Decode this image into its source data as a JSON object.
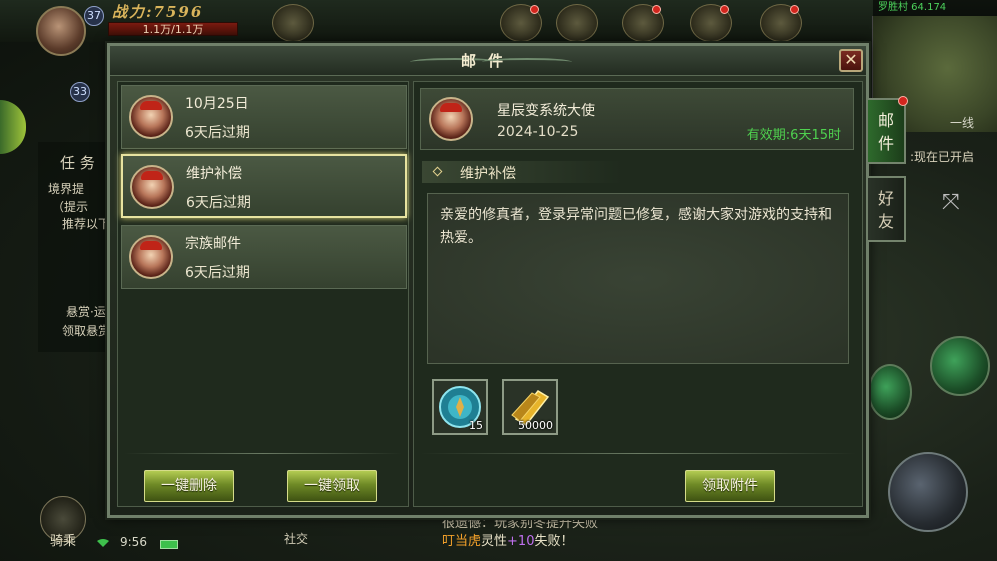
{
  "hud": {
    "power": "战力:7596",
    "hp": "1.1万/1.1万",
    "level_main": "37",
    "level_pet": "33",
    "map_coords": "罗胜村 64.174",
    "line": "一线",
    "quest_tab": "任 务",
    "quest_1": "境界提",
    "quest_1_hint": "（提示",
    "quest_1_sub": "推荐以下",
    "quest_2": "悬赏·运",
    "quest_2_sub": "领取悬赏",
    "time": "9:56",
    "ride": "骑乘",
    "social": "社交",
    "chat_line1": "很遗憾：玩家别冬提升失败",
    "chat_name": "叮当虎",
    "chat_pre": "灵性",
    "chat_plus": "+10",
    "chat_post": "失败！",
    "minimap_note": ":现在已开启"
  },
  "dialog": {
    "title": "邮件",
    "close_label": "✕"
  },
  "mail_list": [
    {
      "subject": "10月25日",
      "expiry": "6天后过期"
    },
    {
      "subject": "维护补偿",
      "expiry": "6天后过期"
    },
    {
      "subject": "宗族邮件",
      "expiry": "6天后过期"
    }
  ],
  "buttons": {
    "delete_all": "一键删除",
    "claim_all": "一键领取",
    "claim_attachment": "领取附件"
  },
  "detail": {
    "sender": "星辰变系统大使",
    "date": "2024-10-25",
    "validity": "有效期:6天15时",
    "subject": "维护补偿",
    "body": "亲爱的修真者，登录异常问题已修复，感谢大家对游戏的支持和热爱。",
    "attachments": [
      {
        "icon": "teal-orb-icon",
        "count": "15"
      },
      {
        "icon": "gold-ticket-icon",
        "count": "50000"
      }
    ]
  },
  "side_tabs": {
    "mail": "邮件",
    "friends": "好友"
  },
  "colors": {
    "validity_green": "#4fd14f",
    "accent_gold": "#d9b45b",
    "red_dot": "#d2261e"
  }
}
